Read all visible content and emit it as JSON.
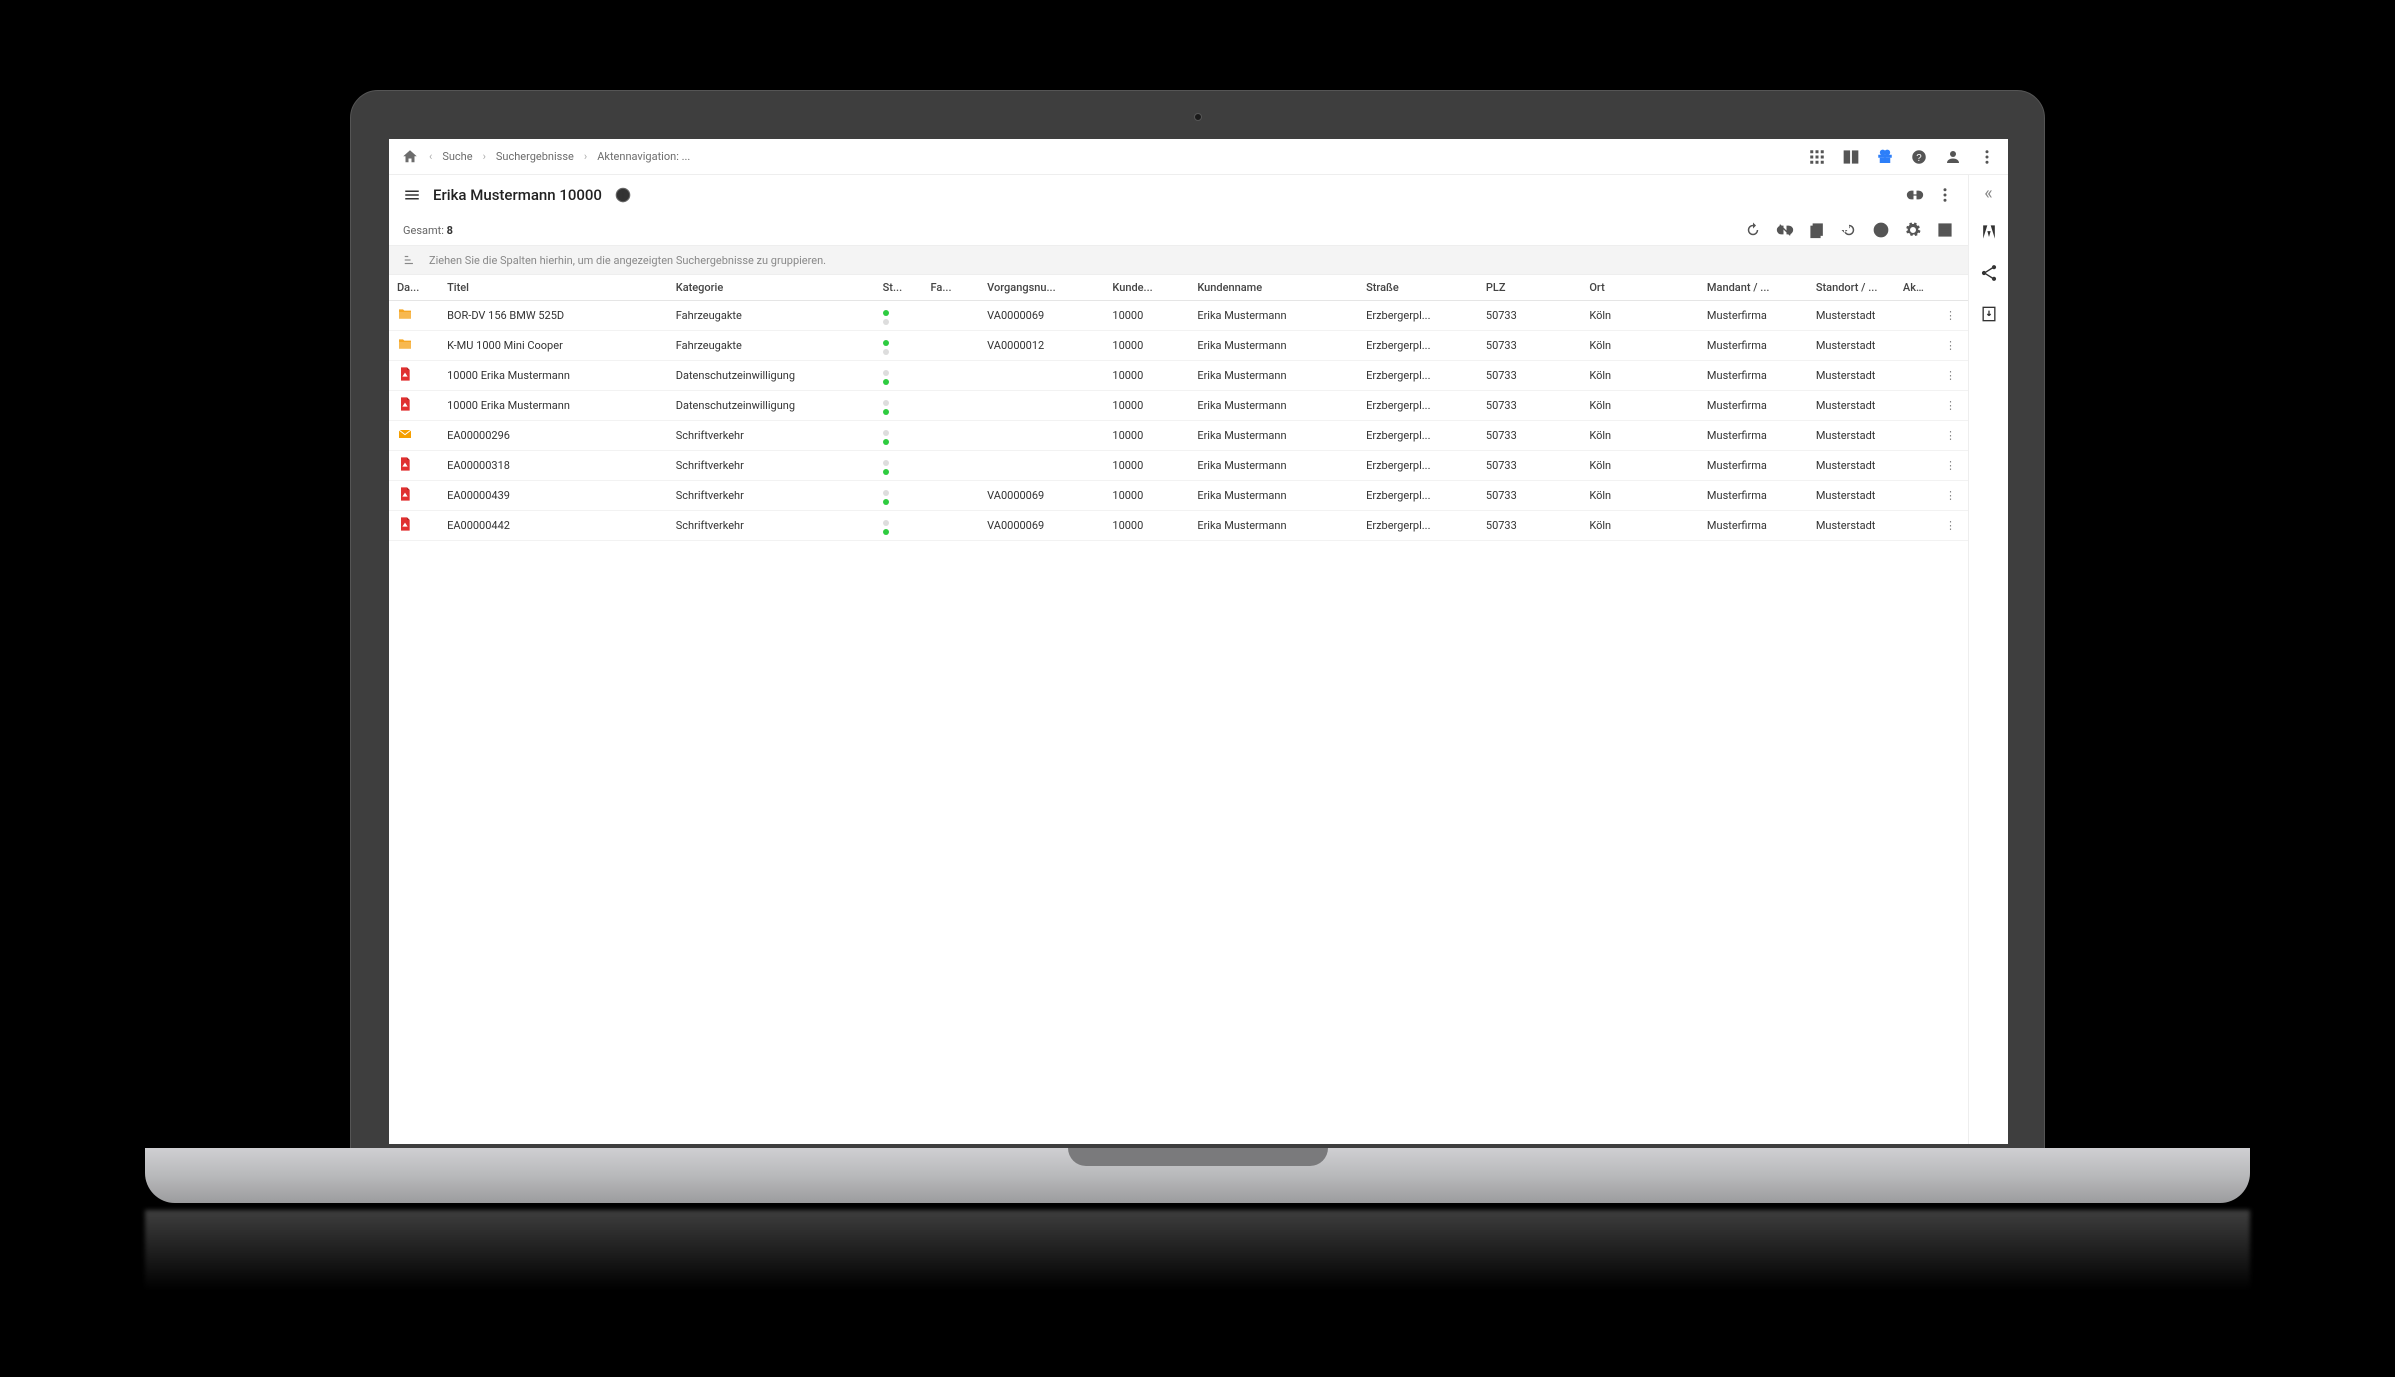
{
  "breadcrumbs": {
    "items": [
      "Suche",
      "Suchergebnisse",
      "Aktennavigation: ..."
    ]
  },
  "header": {
    "title": "Erika Mustermann 10000"
  },
  "count": {
    "label": "Gesamt:",
    "value": "8"
  },
  "groupBar": {
    "hint": "Ziehen Sie die Spalten hierhin, um die angezeigten Suchergebnisse zu gruppieren."
  },
  "columns": {
    "da": "Da...",
    "titel": "Titel",
    "kategorie": "Kategorie",
    "st": "St...",
    "fa": "Fa...",
    "vorgang": "Vorgangsnu...",
    "kunde": "Kunde...",
    "kundenname": "Kundenname",
    "strasse": "Straße",
    "plz": "PLZ",
    "ort": "Ort",
    "mandant": "Mandant / ...",
    "standort": "Standort / ...",
    "ak": "Ak..."
  },
  "rows": [
    {
      "icon": "folder",
      "titel": "BOR-DV 156 BMW 525D",
      "kategorie": "Fahrzeugakte",
      "status": [
        "green",
        "grey"
      ],
      "vorgang": "VA0000069",
      "kunde": "10000",
      "kundenname": "Erika Mustermann",
      "strasse": "Erzbergerpl...",
      "plz": "50733",
      "ort": "Köln",
      "mandant": "Musterfirma",
      "standort": "Musterstadt"
    },
    {
      "icon": "folder",
      "titel": "K-MU 1000 Mini Cooper",
      "kategorie": "Fahrzeugakte",
      "status": [
        "green",
        "grey"
      ],
      "vorgang": "VA0000012",
      "kunde": "10000",
      "kundenname": "Erika Mustermann",
      "strasse": "Erzbergerpl...",
      "plz": "50733",
      "ort": "Köln",
      "mandant": "Musterfirma",
      "standort": "Musterstadt"
    },
    {
      "icon": "pdf",
      "titel": "10000 Erika Mustermann",
      "kategorie": "Datenschutzeinwilligung",
      "status": [
        "grey",
        "green"
      ],
      "vorgang": "",
      "kunde": "10000",
      "kundenname": "Erika Mustermann",
      "strasse": "Erzbergerpl...",
      "plz": "50733",
      "ort": "Köln",
      "mandant": "Musterfirma",
      "standort": "Musterstadt"
    },
    {
      "icon": "pdf",
      "titel": "10000 Erika Mustermann",
      "kategorie": "Datenschutzeinwilligung",
      "status": [
        "grey",
        "green"
      ],
      "vorgang": "",
      "kunde": "10000",
      "kundenname": "Erika Mustermann",
      "strasse": "Erzbergerpl...",
      "plz": "50733",
      "ort": "Köln",
      "mandant": "Musterfirma",
      "standort": "Musterstadt"
    },
    {
      "icon": "mail",
      "titel": "EA00000296",
      "kategorie": "Schriftverkehr",
      "status": [
        "grey",
        "green"
      ],
      "vorgang": "",
      "kunde": "10000",
      "kundenname": "Erika Mustermann",
      "strasse": "Erzbergerpl...",
      "plz": "50733",
      "ort": "Köln",
      "mandant": "Musterfirma",
      "standort": "Musterstadt"
    },
    {
      "icon": "pdf",
      "titel": "EA00000318",
      "kategorie": "Schriftverkehr",
      "status": [
        "grey",
        "green"
      ],
      "vorgang": "",
      "kunde": "10000",
      "kundenname": "Erika Mustermann",
      "strasse": "Erzbergerpl...",
      "plz": "50733",
      "ort": "Köln",
      "mandant": "Musterfirma",
      "standort": "Musterstadt"
    },
    {
      "icon": "pdf",
      "titel": "EA00000439",
      "kategorie": "Schriftverkehr",
      "status": [
        "grey",
        "green"
      ],
      "vorgang": "VA0000069",
      "kunde": "10000",
      "kundenname": "Erika Mustermann",
      "strasse": "Erzbergerpl...",
      "plz": "50733",
      "ort": "Köln",
      "mandant": "Musterfirma",
      "standort": "Musterstadt"
    },
    {
      "icon": "pdf",
      "titel": "EA00000442",
      "kategorie": "Schriftverkehr",
      "status": [
        "grey",
        "green"
      ],
      "vorgang": "VA0000069",
      "kunde": "10000",
      "kundenname": "Erika Mustermann",
      "strasse": "Erzbergerpl...",
      "plz": "50733",
      "ort": "Köln",
      "mandant": "Musterfirma",
      "standort": "Musterstadt"
    }
  ]
}
